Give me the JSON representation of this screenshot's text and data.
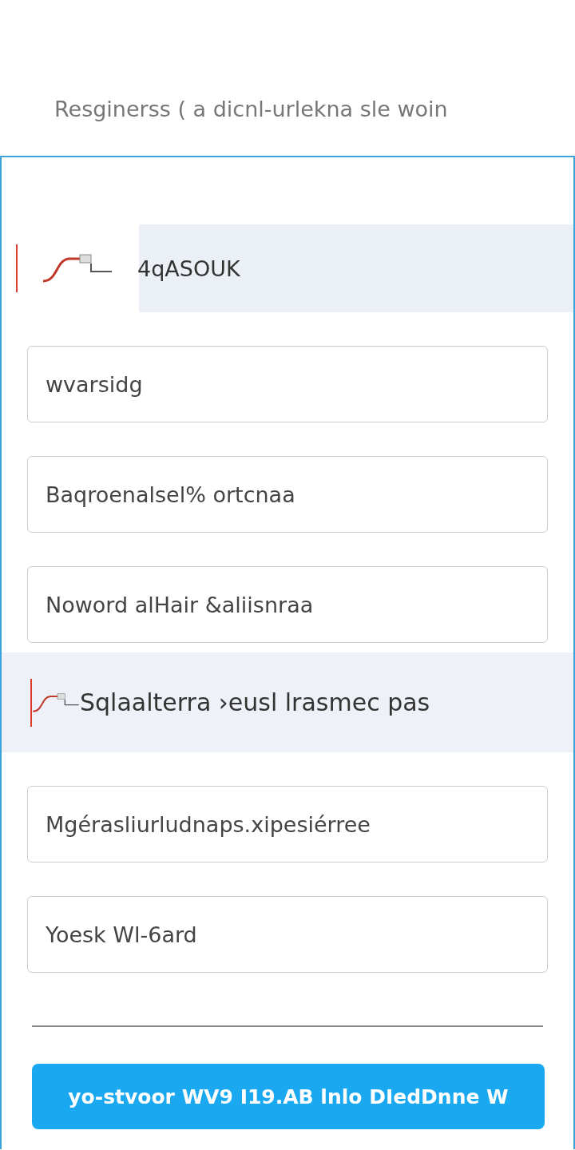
{
  "title": "Resginerss ( a dicnl-urlekna sle woin",
  "sections": [
    {
      "heading": "4qASOUK",
      "fields": [
        {
          "value": "wvarsidg"
        },
        {
          "value": "Baqroenalsel% ortcnaa"
        },
        {
          "value": "Noword alHair &aliisnraa"
        }
      ]
    },
    {
      "heading": "Sqlaalterra ›eusl lrasmec pas",
      "fields": [
        {
          "value": "Mgérasliurludnaps.xipesiérree"
        },
        {
          "value": "Yoesk Wl-6ard"
        }
      ]
    }
  ],
  "submit": "yo-stvoor WV9 I19.AB lnlo DIedDnne W"
}
